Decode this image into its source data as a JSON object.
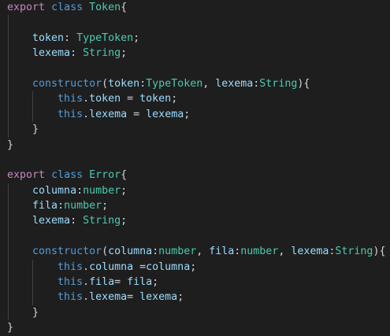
{
  "editor": {
    "lines": [
      [
        {
          "t": "export",
          "c": "keyword"
        },
        {
          "t": " ",
          "c": "plain"
        },
        {
          "t": "class",
          "c": "storage"
        },
        {
          "t": " ",
          "c": "plain"
        },
        {
          "t": "Token",
          "c": "class"
        },
        {
          "t": "{",
          "c": "punc"
        }
      ],
      [],
      [
        {
          "t": "    ",
          "c": "plain"
        },
        {
          "t": "token",
          "c": "prop"
        },
        {
          "t": ": ",
          "c": "punc"
        },
        {
          "t": "TypeToken",
          "c": "type"
        },
        {
          "t": ";",
          "c": "punc"
        }
      ],
      [
        {
          "t": "    ",
          "c": "plain"
        },
        {
          "t": "lexema",
          "c": "prop"
        },
        {
          "t": ": ",
          "c": "punc"
        },
        {
          "t": "String",
          "c": "type"
        },
        {
          "t": ";",
          "c": "punc"
        }
      ],
      [],
      [
        {
          "t": "    ",
          "c": "plain"
        },
        {
          "t": "constructor",
          "c": "storage"
        },
        {
          "t": "(",
          "c": "punc"
        },
        {
          "t": "token",
          "c": "prop"
        },
        {
          "t": ":",
          "c": "punc"
        },
        {
          "t": "TypeToken",
          "c": "type"
        },
        {
          "t": ", ",
          "c": "punc"
        },
        {
          "t": "lexema",
          "c": "prop"
        },
        {
          "t": ":",
          "c": "punc"
        },
        {
          "t": "String",
          "c": "type"
        },
        {
          "t": "){",
          "c": "punc"
        }
      ],
      [
        {
          "t": "        ",
          "c": "plain"
        },
        {
          "t": "this",
          "c": "this"
        },
        {
          "t": ".",
          "c": "punc"
        },
        {
          "t": "token",
          "c": "prop"
        },
        {
          "t": " = ",
          "c": "punc"
        },
        {
          "t": "token",
          "c": "prop"
        },
        {
          "t": ";",
          "c": "punc"
        }
      ],
      [
        {
          "t": "        ",
          "c": "plain"
        },
        {
          "t": "this",
          "c": "this"
        },
        {
          "t": ".",
          "c": "punc"
        },
        {
          "t": "lexema",
          "c": "prop"
        },
        {
          "t": " = ",
          "c": "punc"
        },
        {
          "t": "lexema",
          "c": "prop"
        },
        {
          "t": ";",
          "c": "punc"
        }
      ],
      [
        {
          "t": "    ",
          "c": "plain"
        },
        {
          "t": "}",
          "c": "punc"
        }
      ],
      [
        {
          "t": "}",
          "c": "punc"
        }
      ],
      [],
      [
        {
          "t": "export",
          "c": "keyword"
        },
        {
          "t": " ",
          "c": "plain"
        },
        {
          "t": "class",
          "c": "storage"
        },
        {
          "t": " ",
          "c": "plain"
        },
        {
          "t": "Error",
          "c": "class"
        },
        {
          "t": "{",
          "c": "punc"
        }
      ],
      [
        {
          "t": "    ",
          "c": "plain"
        },
        {
          "t": "columna",
          "c": "prop"
        },
        {
          "t": ":",
          "c": "punc"
        },
        {
          "t": "number",
          "c": "type"
        },
        {
          "t": ";",
          "c": "punc"
        }
      ],
      [
        {
          "t": "    ",
          "c": "plain"
        },
        {
          "t": "fila",
          "c": "prop"
        },
        {
          "t": ":",
          "c": "punc"
        },
        {
          "t": "number",
          "c": "type"
        },
        {
          "t": ";",
          "c": "punc"
        }
      ],
      [
        {
          "t": "    ",
          "c": "plain"
        },
        {
          "t": "lexema",
          "c": "prop"
        },
        {
          "t": ": ",
          "c": "punc"
        },
        {
          "t": "String",
          "c": "type"
        },
        {
          "t": ";",
          "c": "punc"
        }
      ],
      [],
      [
        {
          "t": "    ",
          "c": "plain"
        },
        {
          "t": "constructor",
          "c": "storage"
        },
        {
          "t": "(",
          "c": "punc"
        },
        {
          "t": "columna",
          "c": "prop"
        },
        {
          "t": ":",
          "c": "punc"
        },
        {
          "t": "number",
          "c": "type"
        },
        {
          "t": ", ",
          "c": "punc"
        },
        {
          "t": "fila",
          "c": "prop"
        },
        {
          "t": ":",
          "c": "punc"
        },
        {
          "t": "number",
          "c": "type"
        },
        {
          "t": ", ",
          "c": "punc"
        },
        {
          "t": "lexema",
          "c": "prop"
        },
        {
          "t": ":",
          "c": "punc"
        },
        {
          "t": "String",
          "c": "type"
        },
        {
          "t": "){",
          "c": "punc"
        }
      ],
      [
        {
          "t": "        ",
          "c": "plain"
        },
        {
          "t": "this",
          "c": "this"
        },
        {
          "t": ".",
          "c": "punc"
        },
        {
          "t": "columna",
          "c": "prop"
        },
        {
          "t": " =",
          "c": "punc"
        },
        {
          "t": "columna",
          "c": "prop"
        },
        {
          "t": ";",
          "c": "punc"
        }
      ],
      [
        {
          "t": "        ",
          "c": "plain"
        },
        {
          "t": "this",
          "c": "this"
        },
        {
          "t": ".",
          "c": "punc"
        },
        {
          "t": "fila",
          "c": "prop"
        },
        {
          "t": "= ",
          "c": "punc"
        },
        {
          "t": "fila",
          "c": "prop"
        },
        {
          "t": ";",
          "c": "punc"
        }
      ],
      [
        {
          "t": "        ",
          "c": "plain"
        },
        {
          "t": "this",
          "c": "this"
        },
        {
          "t": ".",
          "c": "punc"
        },
        {
          "t": "lexema",
          "c": "prop"
        },
        {
          "t": "= ",
          "c": "punc"
        },
        {
          "t": "lexema",
          "c": "prop"
        },
        {
          "t": ";",
          "c": "punc"
        }
      ],
      [
        {
          "t": "    ",
          "c": "plain"
        },
        {
          "t": "}",
          "c": "punc"
        }
      ],
      [
        {
          "t": "}",
          "c": "punc"
        }
      ]
    ]
  },
  "colors": {
    "background": "#1e1e1e",
    "keyword": "#c586c0",
    "storage": "#569cd6",
    "class": "#4ec9b0",
    "prop": "#9cdcfe",
    "type": "#4ec9b0",
    "punc": "#d4d4d4",
    "this": "#569cd6"
  }
}
